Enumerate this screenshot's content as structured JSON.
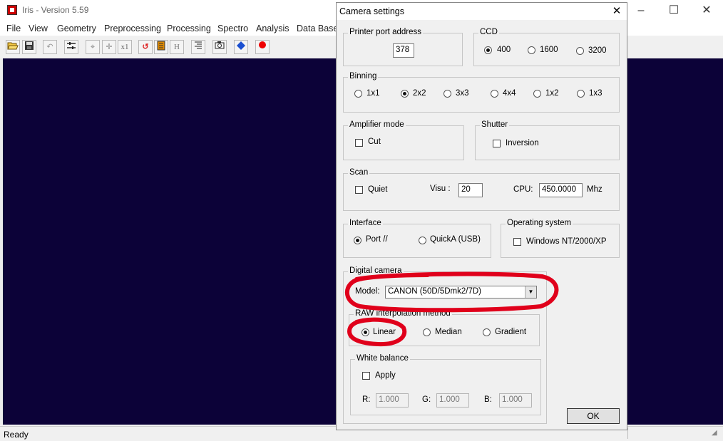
{
  "app": {
    "title": "Iris - Version 5.59",
    "menu": [
      "File",
      "View",
      "Geometry",
      "Preprocessing",
      "Processing",
      "Spectro",
      "Analysis",
      "Data Base"
    ],
    "status": "Ready",
    "window_controls": {
      "minimize": "–",
      "maximize": "☐",
      "close": "✕"
    },
    "toolbar_icons": [
      "open-icon",
      "save-icon",
      "undo-icon",
      "settings-icon",
      "target-icon",
      "move-icon",
      "x1-icon",
      "refresh-icon",
      "list-icon",
      "h-icon",
      "threshold-icon",
      "camera-icon",
      "blue-diamond-icon",
      "record-icon"
    ],
    "toolbar_labels": {
      "x1": "x1",
      "h": "H"
    },
    "canvas_color": "#0c0238"
  },
  "dialog": {
    "title": "Camera settings",
    "close": "✕",
    "printer_port": {
      "label": "Printer port address",
      "value": "378"
    },
    "ccd": {
      "label": "CCD",
      "options": [
        "400",
        "1600",
        "3200"
      ],
      "selected": "400"
    },
    "binning": {
      "label": "Binning",
      "options": [
        "1x1",
        "2x2",
        "3x3",
        "4x4",
        "1x2",
        "1x3"
      ],
      "selected": "2x2"
    },
    "amplifier": {
      "label": "Amplifier mode",
      "cut_label": "Cut",
      "cut_checked": false
    },
    "shutter": {
      "label": "Shutter",
      "inversion_label": "Inversion",
      "inversion_checked": false
    },
    "scan": {
      "label": "Scan",
      "quiet_label": "Quiet",
      "visu_label": "Visu :",
      "visu_value": "20",
      "cpu_label": "CPU:",
      "cpu_value": "450.0000",
      "cpu_unit": "Mhz"
    },
    "interface": {
      "label": "Interface",
      "options": [
        "Port //",
        "QuickA (USB)"
      ],
      "selected": "Port //"
    },
    "os": {
      "label": "Operating system",
      "windows_label": "Windows NT/2000/XP",
      "windows_checked": false
    },
    "digital_camera": {
      "label": "Digital camera",
      "model_label": "Model:",
      "model_value": "CANON (50D/5Dmk2/7D)"
    },
    "raw_interp": {
      "label": "RAW interpolation method",
      "options": [
        "Linear",
        "Median",
        "Gradient"
      ],
      "selected": "Linear"
    },
    "white_balance": {
      "label": "White balance",
      "apply_label": "Apply",
      "r_label": "R:",
      "r_value": "1.000",
      "g_label": "G:",
      "g_value": "1.000",
      "b_label": "B:",
      "b_value": "1.000"
    },
    "ok_label": "OK"
  },
  "annotation_color": "#e0001b"
}
